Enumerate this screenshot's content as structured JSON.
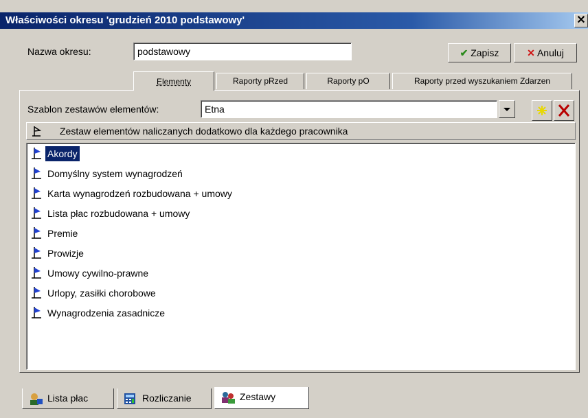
{
  "window": {
    "title": "Właściwości okresu 'grudzień 2010 podstawowy'",
    "close_label": "✕"
  },
  "form": {
    "name_label": "Nazwa okresu:",
    "name_value": "podstawowy",
    "save_label": "Zapisz",
    "cancel_label": "Anuluj"
  },
  "tabs": [
    {
      "label": "Elementy",
      "active": true
    },
    {
      "label": "Raporty pRzed",
      "active": false
    },
    {
      "label": "Raporty pO",
      "active": false
    },
    {
      "label": "Raporty przed wyszukaniem Zdarzen",
      "active": false
    }
  ],
  "template": {
    "label": "Szablon zestawów elementów:",
    "value": "Etna"
  },
  "list": {
    "header": "Zestaw elementów naliczanych dodatkowo dla każdego pracownika",
    "items": [
      "Akordy",
      "Domyślny system wynagrodzeń",
      "Karta wynagrodzeń rozbudowana + umowy",
      "Lista płac rozbudowana + umowy",
      "Premie",
      "Prowizje",
      "Umowy cywilno-prawne",
      "Urlopy, zasiłki chorobowe",
      "Wynagrodzenia zasadnicze"
    ],
    "selected_index": 0
  },
  "bottom_tabs": [
    {
      "label": "Lista płac",
      "icon": "person-icon"
    },
    {
      "label": "Rozliczanie",
      "icon": "calculator-icon"
    },
    {
      "label": "Zestawy",
      "icon": "sets-icon"
    }
  ],
  "colors": {
    "selection": "#0a246a",
    "face": "#d4d0c8",
    "title_start": "#0a246a"
  }
}
